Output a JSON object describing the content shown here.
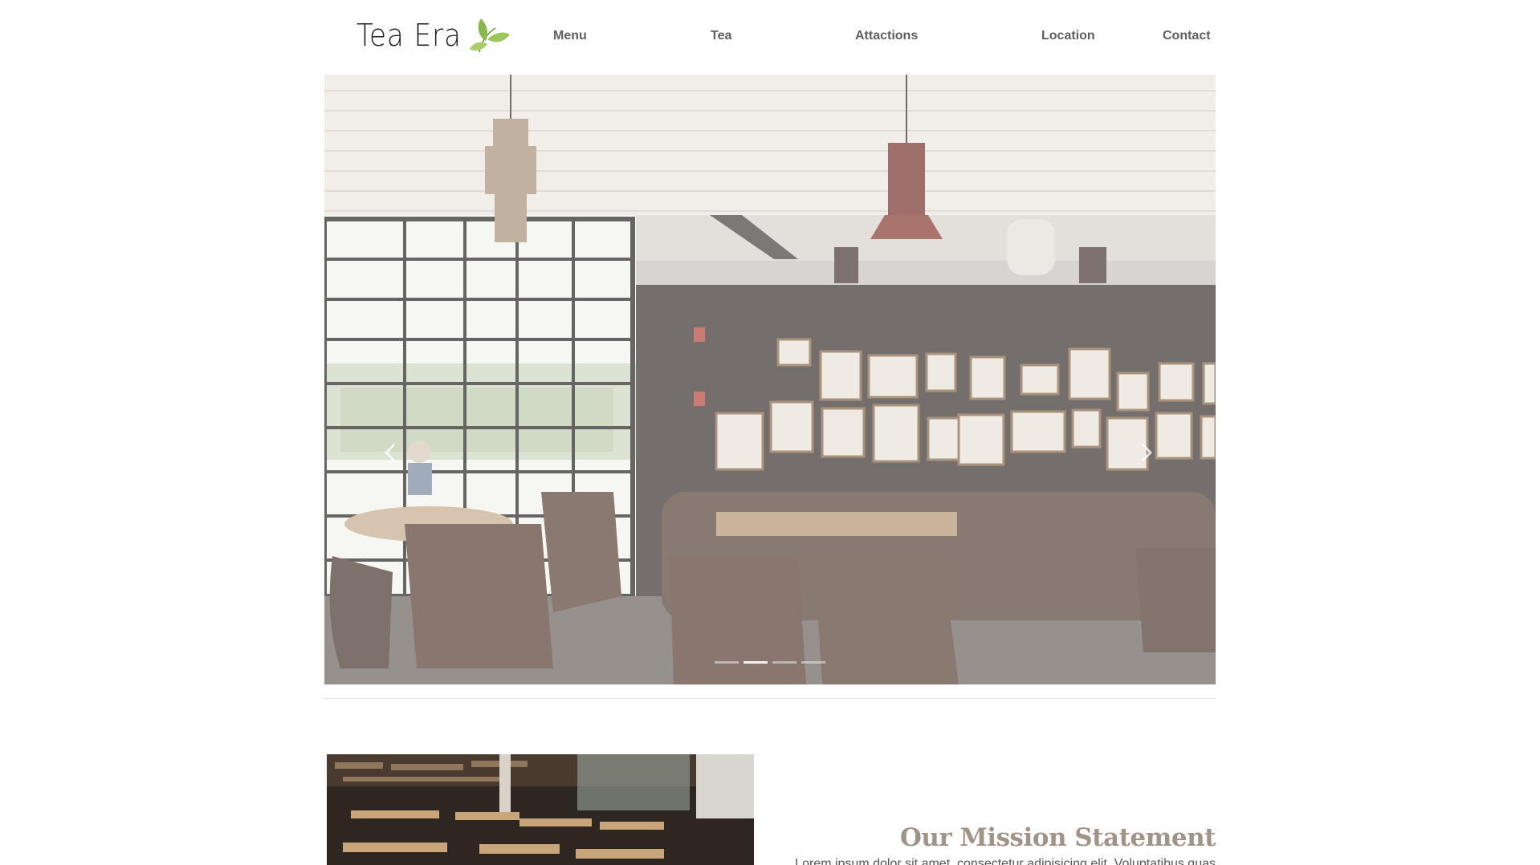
{
  "brand": {
    "logo_text": "Tea Era",
    "logo_icon": "tea-leaf-icon",
    "leaf_color": "#8bb84a"
  },
  "nav": {
    "items": [
      {
        "label": "Menu"
      },
      {
        "label": "Tea"
      },
      {
        "label": "Attactions"
      },
      {
        "label": "Location"
      },
      {
        "label": "Contact"
      }
    ]
  },
  "carousel": {
    "prev_icon": "chevron-left-icon",
    "next_icon": "chevron-right-icon",
    "slide_count": 4,
    "active_slide": 2
  },
  "mission": {
    "title": "Our Mission Statement",
    "body": "Lorem ipsum dolor sit amet, consectetur adipisicing elit. Voluptatibus quas",
    "title_color": "#a09488"
  }
}
